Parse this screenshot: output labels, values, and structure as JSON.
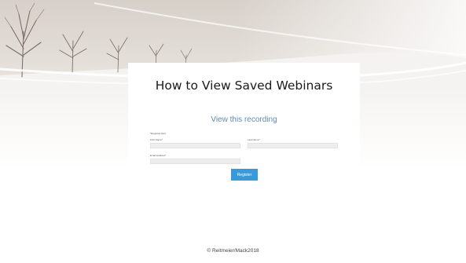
{
  "form": {
    "title": "How to View Saved Webinars",
    "subtitle": "View this recording",
    "required_note": "*Required field",
    "first_name_label": "First Name*",
    "last_name_label": "Last Name*",
    "email_label": "Email Address*",
    "first_name_value": "",
    "last_name_value": "",
    "email_value": "",
    "register_label": "Register"
  },
  "footer": {
    "credit": "© Reitmeier/Mack2018"
  },
  "colors": {
    "accent_button": "#3a9ad9",
    "subtitle_text": "#5f8bb0",
    "banner_sky": "#dcd6cf"
  },
  "icons": {
    "banner_image": "winter-landscape-with-bare-trees"
  }
}
